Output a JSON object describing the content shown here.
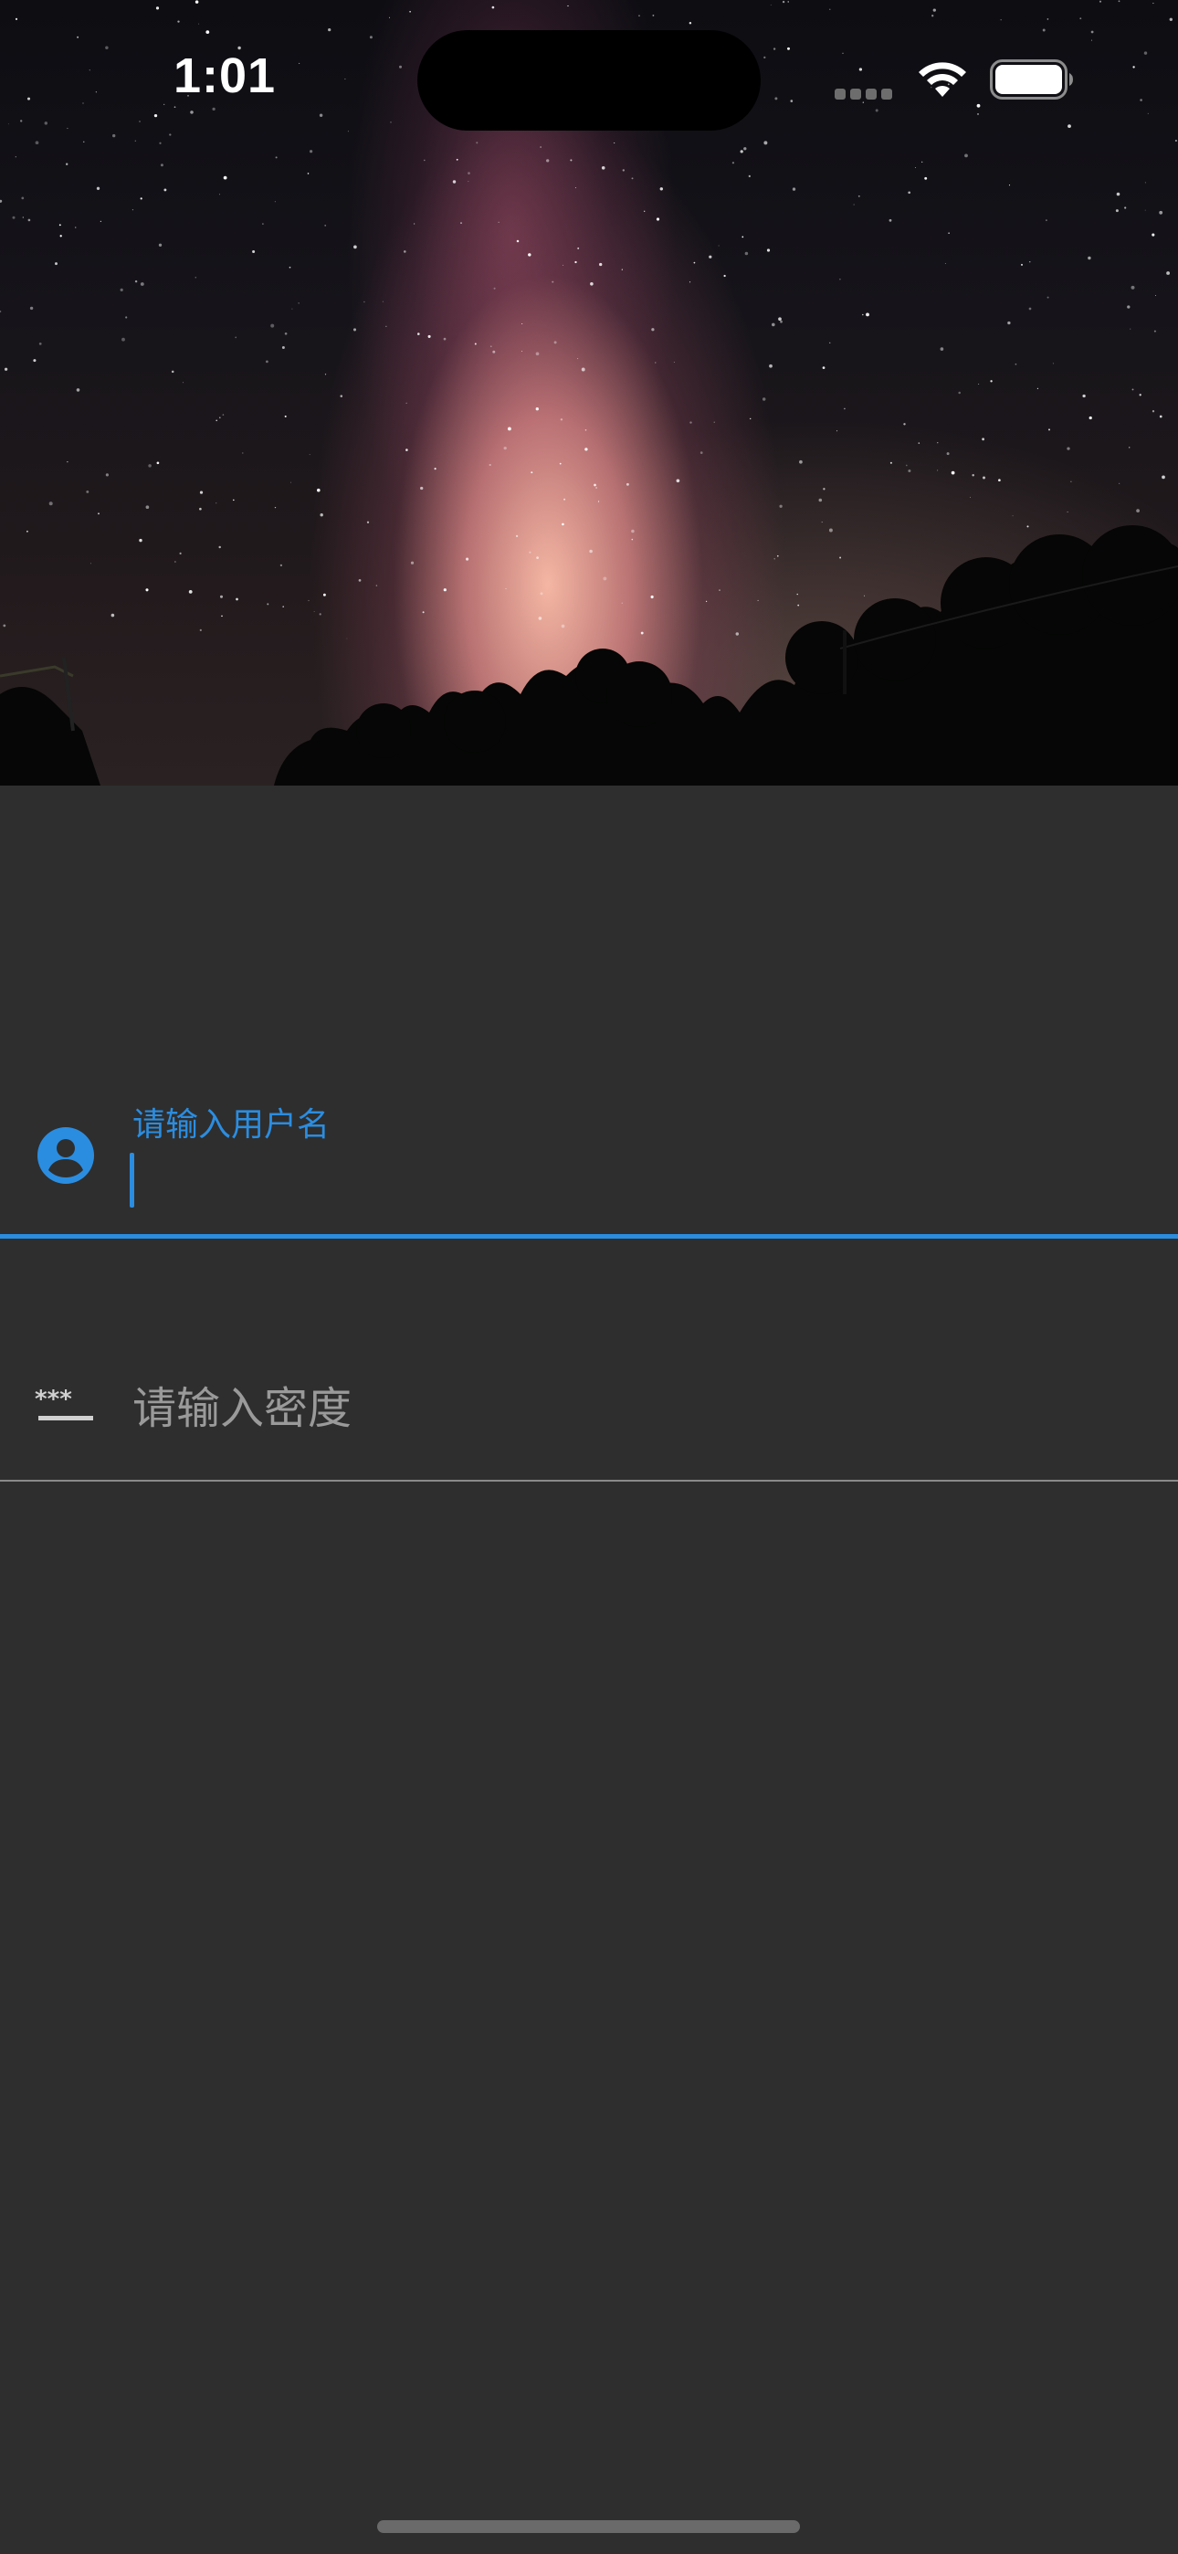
{
  "status_bar": {
    "time": "1:01"
  },
  "hero": {
    "image": "night-sky-milky-way"
  },
  "login_form": {
    "username": {
      "label": "请输入用户名",
      "value": "",
      "icon": "account-circle-icon",
      "focused": true
    },
    "password": {
      "placeholder": "请输入密度",
      "value": "",
      "icon": "password-icon",
      "focused": false
    }
  },
  "colors": {
    "background": "#2e2e2e",
    "accent": "#2b8de0",
    "placeholder": "#9a9a9a",
    "divider": "#8a8a8a"
  }
}
